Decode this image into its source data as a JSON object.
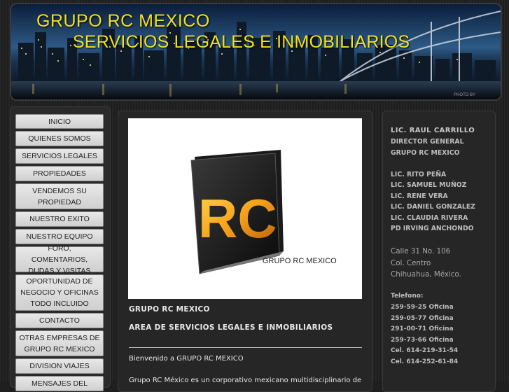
{
  "header": {
    "title_line1": "GRUPO RC MEXICO",
    "title_line2": "SERVICIOS LEGALES E INMOBILIARIOS",
    "photo_credit": "PHOTO BY",
    "title_color": "#f2e21a"
  },
  "nav": {
    "items": [
      {
        "label": "INICIO"
      },
      {
        "label": "QUIENES SOMOS"
      },
      {
        "label": "SERVICIOS LEGALES"
      },
      {
        "label": "PROPIEDADES"
      },
      {
        "label": "VENDEMOS SU PROPIEDAD"
      },
      {
        "label": "NUESTRO EXITO"
      },
      {
        "label": "NUESTRO EQUIPO"
      },
      {
        "label": "FORO, COMENTARIOS, DUDAS Y VISITAS"
      },
      {
        "label": "OPORTUNIDAD DE NEGOCIO Y OFICINAS TODO INCLUIDO"
      },
      {
        "label": "CONTACTO"
      },
      {
        "label": "OTRAS EMPRESAS DE GRUPO RC MEXICO"
      },
      {
        "label": "DIVISION VIAJES"
      },
      {
        "label": "MENSAJES DEL"
      }
    ]
  },
  "content": {
    "logo_letters": "RC",
    "logo_caption": "GRUPO RC MEXICO",
    "heading1": "GRUPO RC MEXICO",
    "heading2": "AREA DE SERVICIOS LEGALES E INMOBILIARIOS",
    "welcome": "Bienvenido a GRUPO RC MEXICO",
    "intro": "Grupo RC México es un corporativo mexicano multidisciplinario de"
  },
  "sidebar": {
    "name": "LIC. RAUL CARRILLO",
    "role": "DIRECTOR GENERAL",
    "company": "GRUPO RC MEXICO",
    "team": [
      "LIC. RITO PEÑA",
      "LIC. SAMUEL MUÑOZ",
      "LIC. RENE VERA",
      "LIC. DANIEL GONZALEZ",
      "LIC. CLAUDIA RIVERA",
      "PD IRVING ANCHONDO"
    ],
    "address": [
      "Calle 31 No. 106",
      "Col. Centro",
      "Chihuahua, México."
    ],
    "phone_label": "Telefono:",
    "phones": [
      "259-59-25 Oficina",
      "259-05-77 Oficina",
      "291-00-71 Oficina",
      "259-73-66 Oficina",
      "Cel. 614-219-31-54",
      "Cel. 614-252-61-84"
    ]
  }
}
